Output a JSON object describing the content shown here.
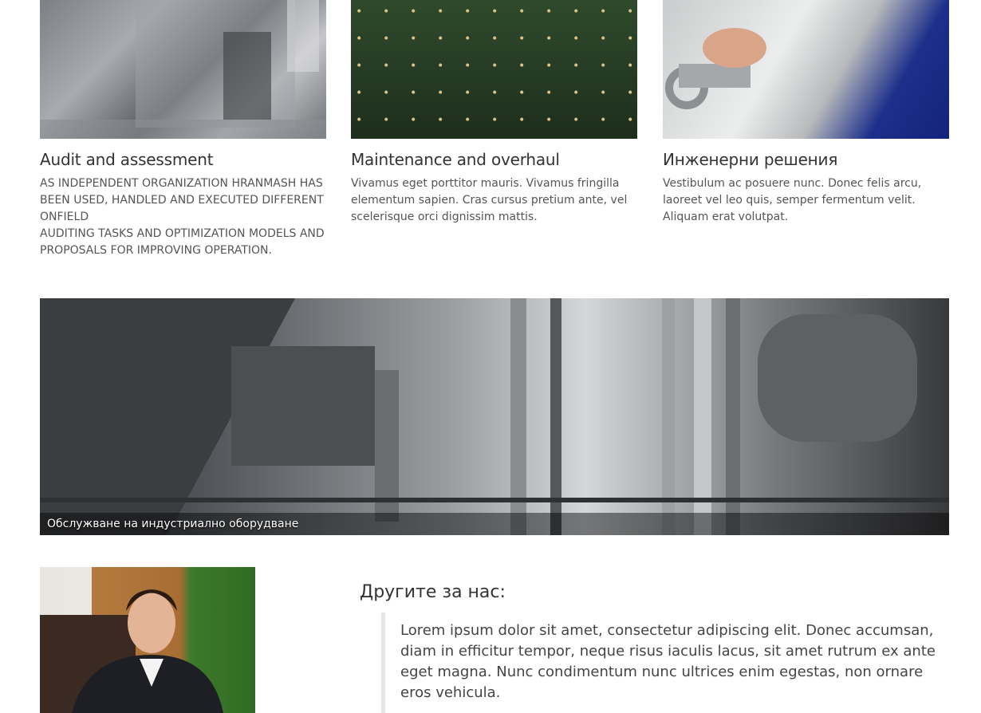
{
  "services": [
    {
      "title": "Audit and assessment",
      "text": "AS INDEPENDENT ORGANIZATION HRANMASH HAS BEEN USED, HANDLED AND EXECUTED DIFFERENT ONFIELD\nAUDITING TASKS AND OPTIMIZATION MODELS AND PROPOSALS FOR IMPROVING OPERATION.",
      "image": "bottling-machine-photo"
    },
    {
      "title": "Maintenance and overhaul",
      "text": "Vivamus eget porttitor mauris. Vivamus fringilla elementum sapien. Cras cursus pretium ante, vel scelerisque orci dignissim mattis.",
      "image": "beer-cans-photo"
    },
    {
      "title": "Инженерни решения",
      "text": "Vestibulum ac posuere nunc. Donec felis arcu, laoreet vel leo quis, semper fermentum velit. Aliquam erat volutpat.",
      "image": "worker-pipes-photo"
    }
  ],
  "banner": {
    "caption": "Обслужване на индустриално оборудване",
    "image": "industrial-plant-photo"
  },
  "testimonials": {
    "title": "Другите за нас:",
    "quote": "Lorem ipsum dolor sit amet, consectetur adipiscing elit. Donec accumsan, diam in efficitur tempor, neque risus iaculis lacus, sit amet rutrum ex ante eget magna. Nunc condimentum nunc ultrices enim egestas, non ornare eros vehicula.",
    "image": "person-portrait-photo"
  }
}
